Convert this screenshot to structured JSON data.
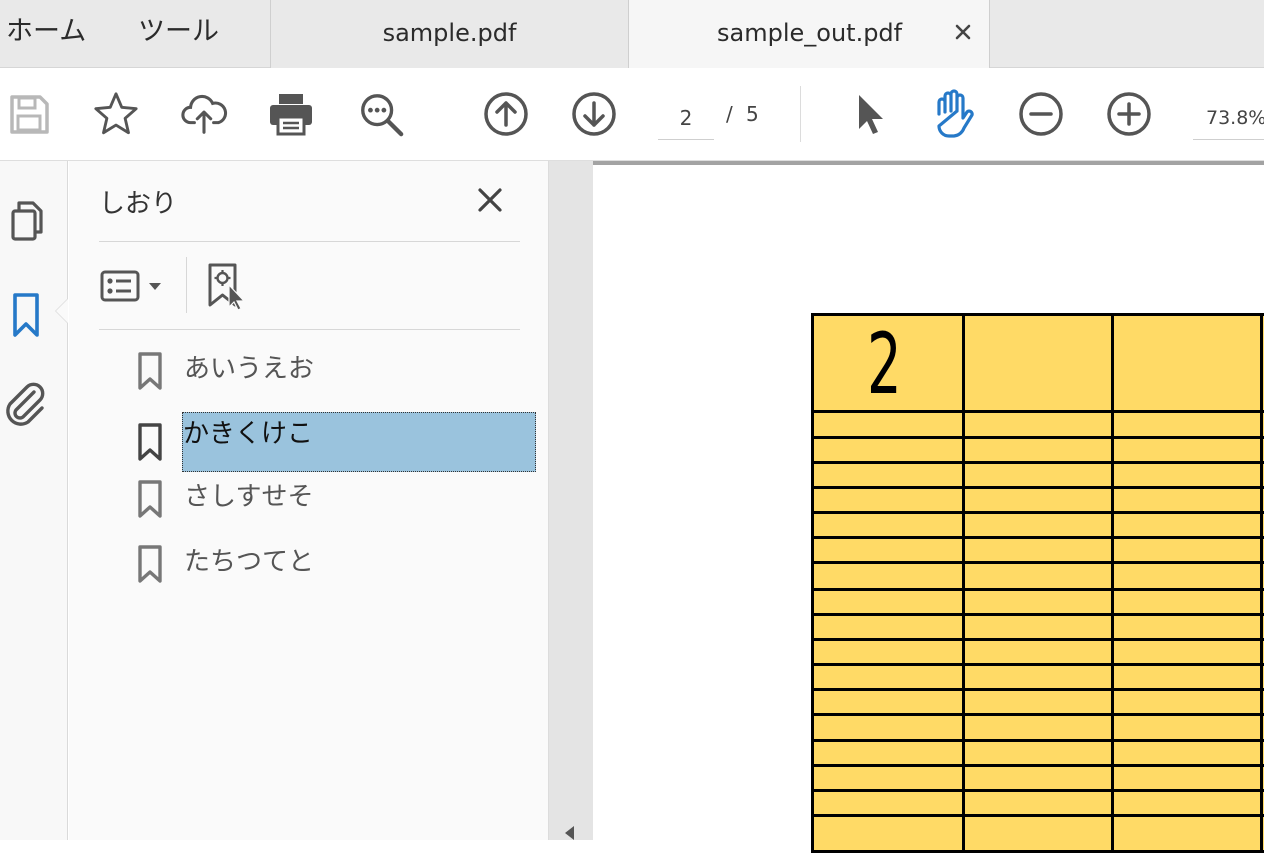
{
  "menu": {
    "home": "ホーム",
    "tools": "ツール"
  },
  "tabs": [
    {
      "label": "sample.pdf",
      "active": false
    },
    {
      "label": "sample_out.pdf",
      "active": true,
      "close": "×"
    }
  ],
  "toolbar": {
    "page_current": "2",
    "page_separator": "/",
    "page_total": "5",
    "zoom": "73.8%",
    "active_tool": "hand",
    "accent_color": "#2679c8"
  },
  "sidebar": {
    "title": "しおり",
    "bookmarks": [
      {
        "label": "あいうえお",
        "selected": false
      },
      {
        "label": "かきくけこ",
        "selected": true
      },
      {
        "label": "さしすせそ",
        "selected": false
      },
      {
        "label": "たちつてと",
        "selected": false
      }
    ]
  },
  "document": {
    "cell_value": "2",
    "fill_color": "#ffda66"
  }
}
